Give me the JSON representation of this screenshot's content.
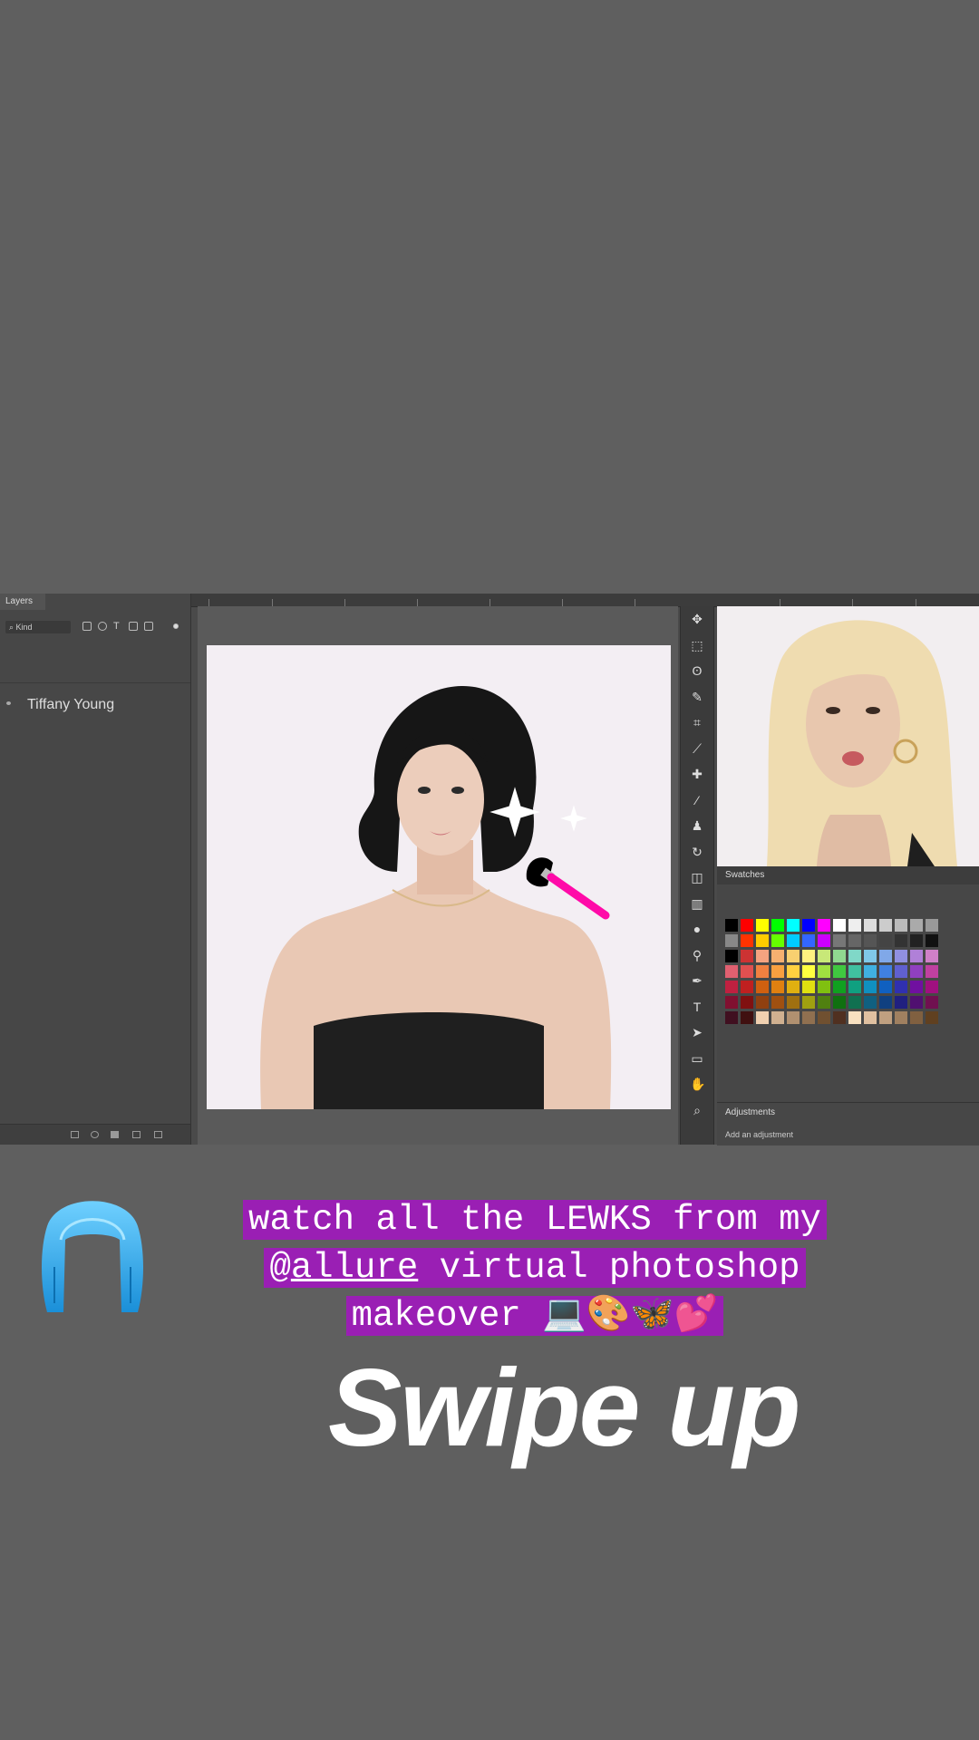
{
  "app": {
    "layers_tab": "Layers",
    "kind_filter": "Kind"
  },
  "layers": [
    {
      "name": "Tiffany Young"
    }
  ],
  "panels": {
    "swatches_title": "Swatches",
    "adjustments_title": "Adjustments",
    "adjustments_hint": "Add an adjustment"
  },
  "toolbar_tools": [
    "move-icon",
    "marquee-icon",
    "lasso-icon",
    "quick-select-icon",
    "crop-icon",
    "eyedropper-icon",
    "healing-icon",
    "brush-icon",
    "stamp-icon",
    "history-brush-icon",
    "eraser-icon",
    "gradient-icon",
    "blur-icon",
    "dodge-icon",
    "pen-icon",
    "type-icon",
    "path-select-icon",
    "rectangle-icon",
    "hand-icon",
    "zoom-icon"
  ],
  "swatch_colors": [
    [
      "#000000",
      "#ff0000",
      "#ffff00",
      "#00ff00",
      "#00ffff",
      "#0000ff",
      "#ff00ff",
      "#ffffff",
      "#eeeeee",
      "#dddddd",
      "#cccccc",
      "#bbbbbb",
      "#aaaaaa",
      "#999999"
    ],
    [
      "#888888",
      "#ff3300",
      "#ffcc00",
      "#66ff00",
      "#00ccff",
      "#3366ff",
      "#cc00ff",
      "#777777",
      "#666666",
      "#555555",
      "#444444",
      "#333333",
      "#222222",
      "#111111"
    ],
    [
      "#000000",
      "#cc3333",
      "#f4a380",
      "#f6b070",
      "#f8d070",
      "#fff080",
      "#c8e878",
      "#90d890",
      "#80d8c8",
      "#80c8e8",
      "#80a8e8",
      "#9090e0",
      "#b080d8",
      "#d080c8"
    ],
    [
      "#e06070",
      "#e05050",
      "#f08040",
      "#f8a040",
      "#ffd040",
      "#ffff40",
      "#a0e040",
      "#40c840",
      "#40c0a0",
      "#40b0e0",
      "#4080e0",
      "#6060d0",
      "#9040c0",
      "#c040a0"
    ],
    [
      "#c02040",
      "#c02020",
      "#d06010",
      "#e08010",
      "#e0b010",
      "#e0e010",
      "#80c010",
      "#10a020",
      "#10a080",
      "#1090c0",
      "#1060c0",
      "#3030b0",
      "#7010a0",
      "#a01080"
    ],
    [
      "#801030",
      "#801010",
      "#904010",
      "#a05010",
      "#a07010",
      "#a0a010",
      "#508010",
      "#107010",
      "#107050",
      "#106080",
      "#104080",
      "#202080",
      "#501070",
      "#701050"
    ],
    [
      "#401020",
      "#401010",
      "#f0d0b0",
      "#d0b090",
      "#b09070",
      "#907050",
      "#705030",
      "#503020",
      "#f8e0c0",
      "#e0c0a0",
      "#c0a080",
      "#a08060",
      "#806040",
      "#604020"
    ]
  ],
  "caption": {
    "line1": "watch all the LEWKS from my",
    "line2_prefix": "@",
    "line2_mention": "allure",
    "line2_suffix": " virtual photoshop",
    "line3": "makeover 💻🎨🦋💕"
  },
  "sticker": "wig-icon",
  "cta": "Swipe up",
  "colors": {
    "caption_highlight": "#9a1fb4",
    "background": "#5f5f5f",
    "brush_handle": "#ff0aa8"
  }
}
